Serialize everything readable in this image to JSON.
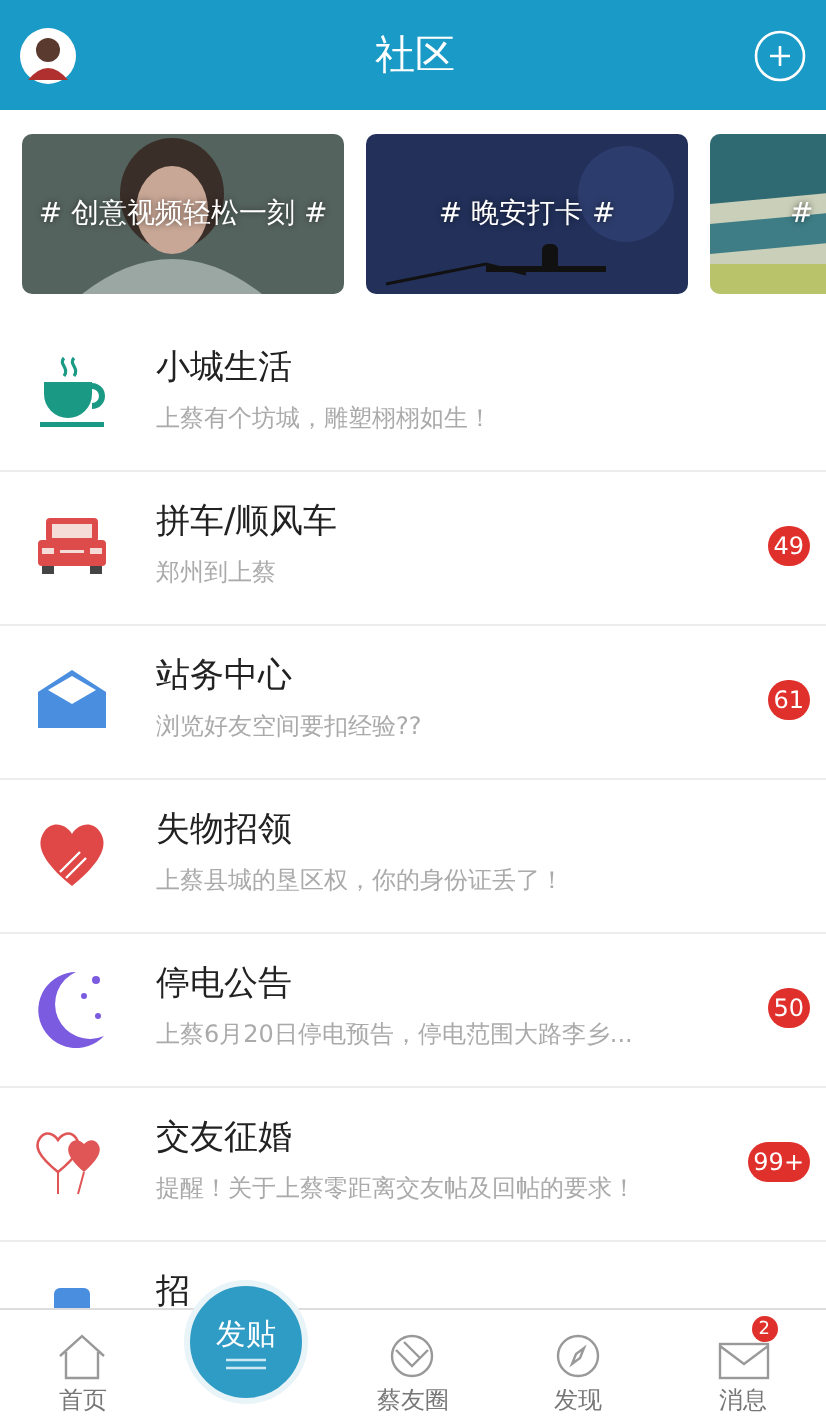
{
  "header": {
    "title": "社区"
  },
  "banners": [
    {
      "label": "# 创意视频轻松一刻 #"
    },
    {
      "label": "# 晚安打卡 #"
    },
    {
      "label": "#"
    }
  ],
  "forums": [
    {
      "title": "小城生活",
      "subtitle": "上蔡有个坊城，雕塑栩栩如生！"
    },
    {
      "title": "拼车/顺风车",
      "subtitle": "郑州到上蔡",
      "badge": "49"
    },
    {
      "title": "站务中心",
      "subtitle": "浏览好友空间要扣经验??",
      "badge": "61"
    },
    {
      "title": "失物招领",
      "subtitle": "上蔡县城的垦区权，你的身份证丢了！"
    },
    {
      "title": "停电公告",
      "subtitle": "上蔡6月20日停电预告，停电范围大路李乡...",
      "badge": "50"
    },
    {
      "title": "交友征婚",
      "subtitle": "提醒！关于上蔡零距离交友帖及回帖的要求！",
      "badge": "99+"
    },
    {
      "title": "招"
    }
  ],
  "tabbar": {
    "post_button": "发贴",
    "items": [
      {
        "label": "首页"
      },
      {
        "label": "蔡友圈"
      },
      {
        "label": "发现"
      },
      {
        "label": "消息",
        "badge": "2"
      }
    ]
  }
}
